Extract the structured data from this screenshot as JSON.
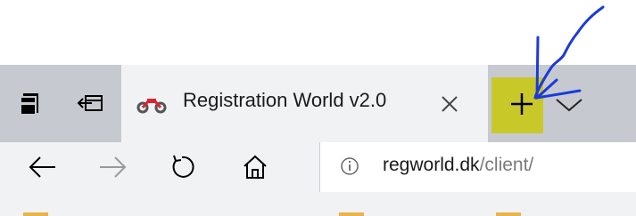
{
  "tab": {
    "title": "Registration World v2.0",
    "favicon": "motorcycle-icon"
  },
  "tabbar": {
    "set_aside_icon": "tabs-aside-icon",
    "restore_icon": "restore-tabs-icon",
    "close_icon": "close-icon",
    "new_tab_icon": "plus-icon",
    "dropdown_icon": "chevron-down-icon",
    "new_tab_highlight_color": "#c9c829"
  },
  "nav": {
    "back_icon": "back-arrow-icon",
    "forward_icon": "forward-arrow-icon",
    "refresh_icon": "refresh-icon",
    "home_icon": "home-icon"
  },
  "address": {
    "info_icon": "info-icon",
    "host": "regworld.dk",
    "path": "/client/"
  },
  "annotation": {
    "color": "#1a3adb",
    "shape": "hand-drawn-arrow-pointing-to-new-tab"
  }
}
